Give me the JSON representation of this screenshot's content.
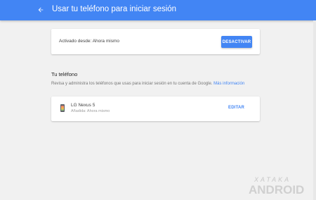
{
  "header": {
    "title": "Usar tu teléfono para iniciar sesión",
    "back_icon": "arrow-back-icon",
    "color": "#4285f4"
  },
  "activation": {
    "status_text": "Activado desde: Ahora mismo",
    "deactivate_label": "DESACTIVAR"
  },
  "phones_section": {
    "title": "Tu teléfono",
    "description": "Revisa y administra los teléfonos que usas para iniciar sesión en tu cuenta de Google.",
    "more_info_link": "Más información",
    "devices": [
      {
        "name": "LG Nexus 5",
        "added": "Añadida: Ahora mismo",
        "icon": "phone-icon",
        "edit_label": "EDITAR"
      }
    ]
  },
  "watermark": {
    "line1": "XATAKA",
    "line2": "ANDROID"
  },
  "colors": {
    "accent": "#4285f4",
    "background": "#f1f1f1",
    "card": "#ffffff"
  }
}
